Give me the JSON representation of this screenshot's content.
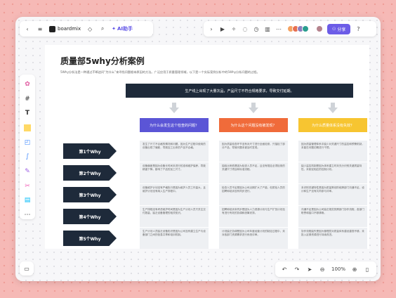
{
  "app": {
    "logo_text": "boardmix",
    "ai_label": "AI助手",
    "share_label": "分享",
    "zoom": "100%"
  },
  "doc": {
    "title": "质量部5why分析案例",
    "subtitle": "5Why分析法是一种通过不断追问“为什么”来寻找问题根本原因的方法。广泛应用于质量管理领域，以下是一个实际案例分析中的5Why分析问题的过程。"
  },
  "banner": "生产线上出现了大量次品，产品尺寸不符合规格要求，导致交付延期。",
  "questions": [
    {
      "label": "为什么会发生这个检查的问题？",
      "color": "#5b55d6"
    },
    {
      "label": "为什么这个问题没有被发现？",
      "color": "#f06b3a"
    },
    {
      "label": "为什么质量体系没有失效？",
      "color": "#f7c531"
    }
  ],
  "whys": [
    "第1个Why",
    "第2个Why",
    "第3个Why",
    "第4个Why",
    "第5个Why"
  ],
  "cells": [
    [
      "发生了尺寸不合格的情况和问题，因为生产过程中使用的设备出现了偏差，导致加工出来的产品不合格。",
      "因为质量检查环节没有对尺寸进行全面检测，只抽检了部分产品，导致问题未被及时发现。",
      "因为质量管理体系中缺少对关键尺寸的监控和预警机制，未能在问题初期进行干预。"
    ],
    [
      "设备偏差是因为设备长时间未进行校准和维护保养，导致精度下降，影响了产品的加工尺寸。",
      "抽检比例低是因为检查人员不足，且没有规定必须检测的关键尺寸项目和标准流程。",
      "缺少监控机制是因为体系建立时未充分识别关键质量特性，未制定相应的控制计划。"
    ],
    [
      "设备维护计划没有严格执行是因为维护人员工作量大，且维护计划没有纳入生产排程中。",
      "检查人员不足是因为公司近期扩大了产能，但质检人员的招聘和培训没有同步进行。",
      "未识别关键特性是因为质量策划阶段跨部门沟通不足，设计和生产没有共同参与评审。"
    ],
    [
      "生产排程没有考虑维护时间是因为生产计划人员只关注交付数量，缺乏设备管理的相关知识。",
      "招聘和培训未同步是因为人力资源计划与生产扩张计划没有进行有效的协调和统筹安排。",
      "沟通不足是因为公司缺乏规范的跨部门协作流程，各部门职责和接口不够清晰。"
    ],
    [
      "生产计划人员缺乏设备知识是因为公司没有建立生产与设备部门之间的信息共享和培训机制。",
      "计划缺乏协调是因为公司年度经营计划的制定过程中，未对各部门资源需求进行系统评审。",
      "协作流程缺失是因为管理层对质量体系建设重视不够，未投入足够资源进行持续改进。"
    ]
  ]
}
